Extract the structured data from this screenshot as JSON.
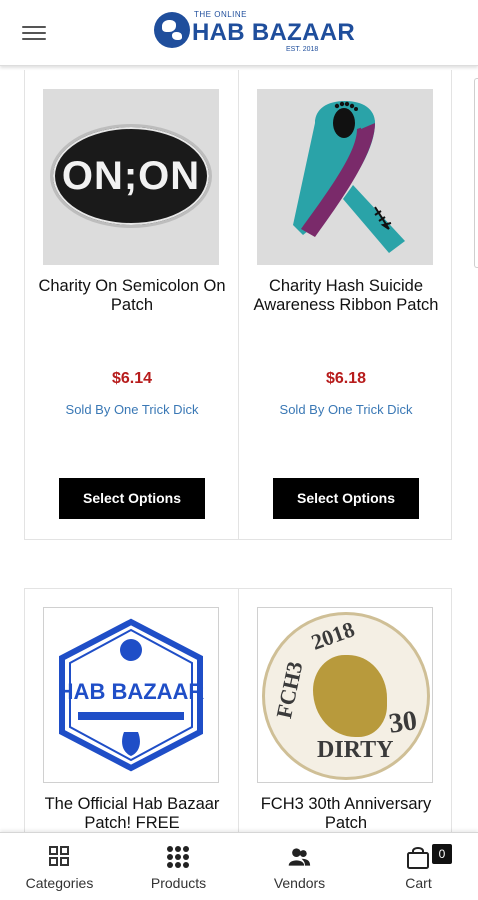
{
  "header": {
    "logo_small": "THE ONLINE",
    "logo_main": "HAB BAZAAR",
    "logo_est": "EST. 2018",
    "menu_icon": "hamburger-icon"
  },
  "products": [
    {
      "title": "Charity On Semicolon On Patch",
      "price": "$6.14",
      "sold_by": "Sold By One Trick Dick",
      "button": "Select Options",
      "image_text": "ON;ON"
    },
    {
      "title": "Charity Hash Suicide Awareness Ribbon Patch",
      "price": "$6.18",
      "sold_by": "Sold By One Trick Dick",
      "button": "Select Options"
    },
    {
      "title": "The Official Hab Bazaar Patch! FREE",
      "image_text": "HAB BAZAAR"
    },
    {
      "title": "FCH3 30th Anniversary Patch",
      "image_text_top": "2018",
      "image_text_left": "FCH3",
      "image_text_right": "30",
      "image_text_bottom": "DIRTY"
    }
  ],
  "bottom_nav": {
    "categories": "Categories",
    "products": "Products",
    "vendors": "Vendors",
    "cart": "Cart",
    "cart_count": "0"
  },
  "colors": {
    "brand": "#1f4e9c",
    "price": "#b71c1c",
    "vendor_link": "#3a78b5",
    "button": "#000000"
  }
}
